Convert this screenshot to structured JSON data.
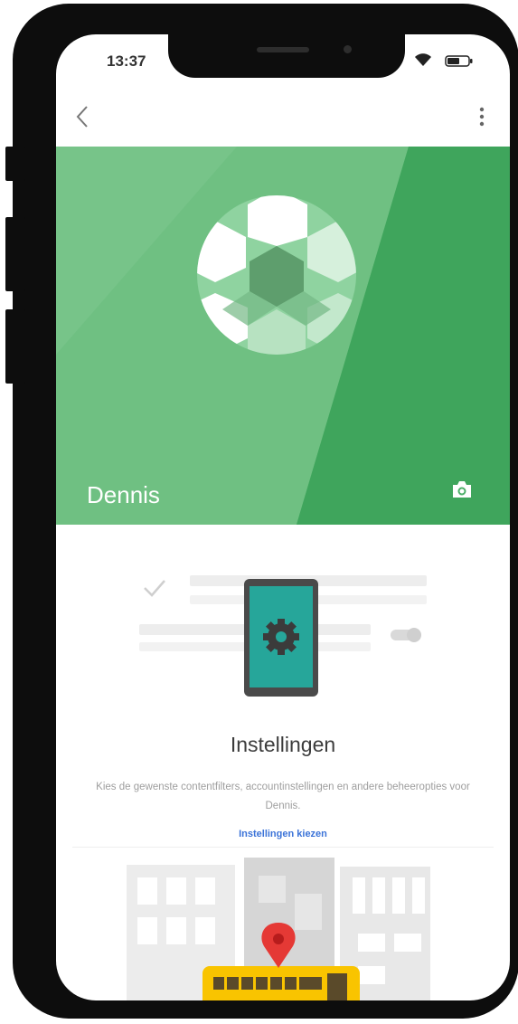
{
  "status_bar": {
    "time": "13:37"
  },
  "profile": {
    "name": "Dennis"
  },
  "settings_card": {
    "title": "Instellingen",
    "description": "Kies de gewenste contentfilters, accountinstellingen en andere beheeropties voor Dennis.",
    "link": "Instellingen kiezen"
  },
  "colors": {
    "hero_green": "#4caf68",
    "link_blue": "#3b73d8",
    "tablet_teal": "#26a69a",
    "pin_red": "#e53935",
    "bus_yellow": "#f9c400"
  },
  "icons": [
    "chevron-left-icon",
    "more-vert-icon",
    "wifi-icon",
    "battery-icon",
    "camera-icon",
    "soccer-ball-avatar",
    "gear-icon",
    "check-icon",
    "toggle-icon",
    "location-pin-icon"
  ]
}
